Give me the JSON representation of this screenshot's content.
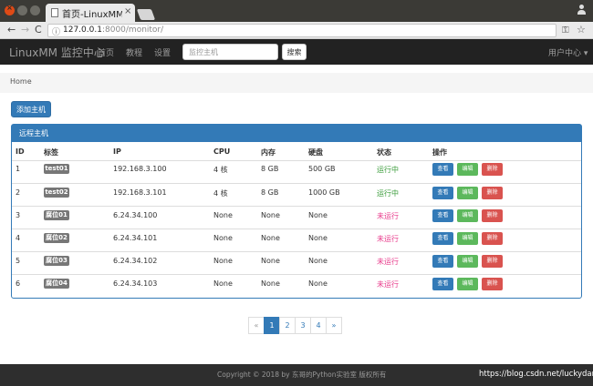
{
  "browser": {
    "tab_title": "首页-LinuxMM监控",
    "tab_close": "×",
    "url_host": "127.0.0.1",
    "url_rest": ":8000/monitor/",
    "back": "←",
    "forward": "→",
    "reload": "C",
    "info": "ⓘ",
    "key": "⚿",
    "star": "☆"
  },
  "navbar": {
    "brand": "LinuxMM 监控中心",
    "links": [
      "首页",
      "教程",
      "设置"
    ],
    "search_placeholder": "监控主机",
    "search_button": "搜索",
    "user_menu": "用户中心 ▾"
  },
  "breadcrumb": {
    "home": "Home"
  },
  "add_button": "添加主机",
  "panel": {
    "title": "远程主机",
    "headers": [
      "ID",
      "标签",
      "IP",
      "CPU",
      "内存",
      "硬盘",
      "状态",
      "操作"
    ],
    "actions": {
      "view": "查看",
      "edit": "编辑",
      "delete": "删除"
    },
    "rows": [
      {
        "id": "1",
        "tag": "test01",
        "ip": "192.168.3.100",
        "cpu": "4 核",
        "mem": "8 GB",
        "disk": "500 GB",
        "status": "运行中",
        "running": true
      },
      {
        "id": "2",
        "tag": "test02",
        "ip": "192.168.3.101",
        "cpu": "4 核",
        "mem": "8 GB",
        "disk": "1000 GB",
        "status": "运行中",
        "running": true
      },
      {
        "id": "3",
        "tag": "腐位01",
        "ip": "6.24.34.100",
        "cpu": "None",
        "mem": "None",
        "disk": "None",
        "status": "未运行",
        "running": false
      },
      {
        "id": "4",
        "tag": "腐位02",
        "ip": "6.24.34.101",
        "cpu": "None",
        "mem": "None",
        "disk": "None",
        "status": "未运行",
        "running": false
      },
      {
        "id": "5",
        "tag": "腐位03",
        "ip": "6.24.34.102",
        "cpu": "None",
        "mem": "None",
        "disk": "None",
        "status": "未运行",
        "running": false
      },
      {
        "id": "6",
        "tag": "腐位04",
        "ip": "6.24.34.103",
        "cpu": "None",
        "mem": "None",
        "disk": "None",
        "status": "未运行",
        "running": false
      }
    ]
  },
  "pagination": {
    "prev": "«",
    "pages": [
      "1",
      "2",
      "3",
      "4"
    ],
    "next": "»",
    "current": "1"
  },
  "footer": {
    "copyright": "Copyright © 2018 by 东哥的Python实验室 版权所有"
  },
  "watermark": "https://blog.csdn.net/luckydarcy",
  "colors": {
    "primary": "#337ab7",
    "success": "#5cb85c",
    "danger": "#d9534f",
    "running": "#3c9d3c",
    "stopped": "#e83a8b"
  }
}
